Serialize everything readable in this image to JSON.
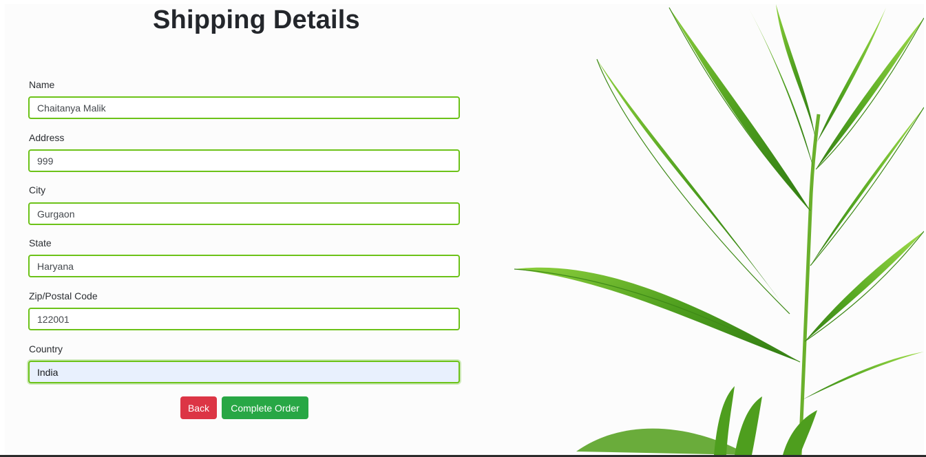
{
  "page": {
    "title": "Shipping Details"
  },
  "form": {
    "fields": [
      {
        "label": "Name",
        "value": "Chaitanya Malik"
      },
      {
        "label": "Address",
        "value": "999"
      },
      {
        "label": "City",
        "value": "Gurgaon"
      },
      {
        "label": "State",
        "value": "Haryana"
      },
      {
        "label": "Zip/Postal Code",
        "value": "122001"
      },
      {
        "label": "Country",
        "value": "India",
        "focused": true
      }
    ]
  },
  "actions": {
    "back_label": "Back",
    "complete_label": "Complete Order"
  },
  "colors": {
    "input_border": "#6cc218",
    "back_button": "#dc3545",
    "complete_button": "#28a745",
    "leaf": "#5fa82a"
  }
}
